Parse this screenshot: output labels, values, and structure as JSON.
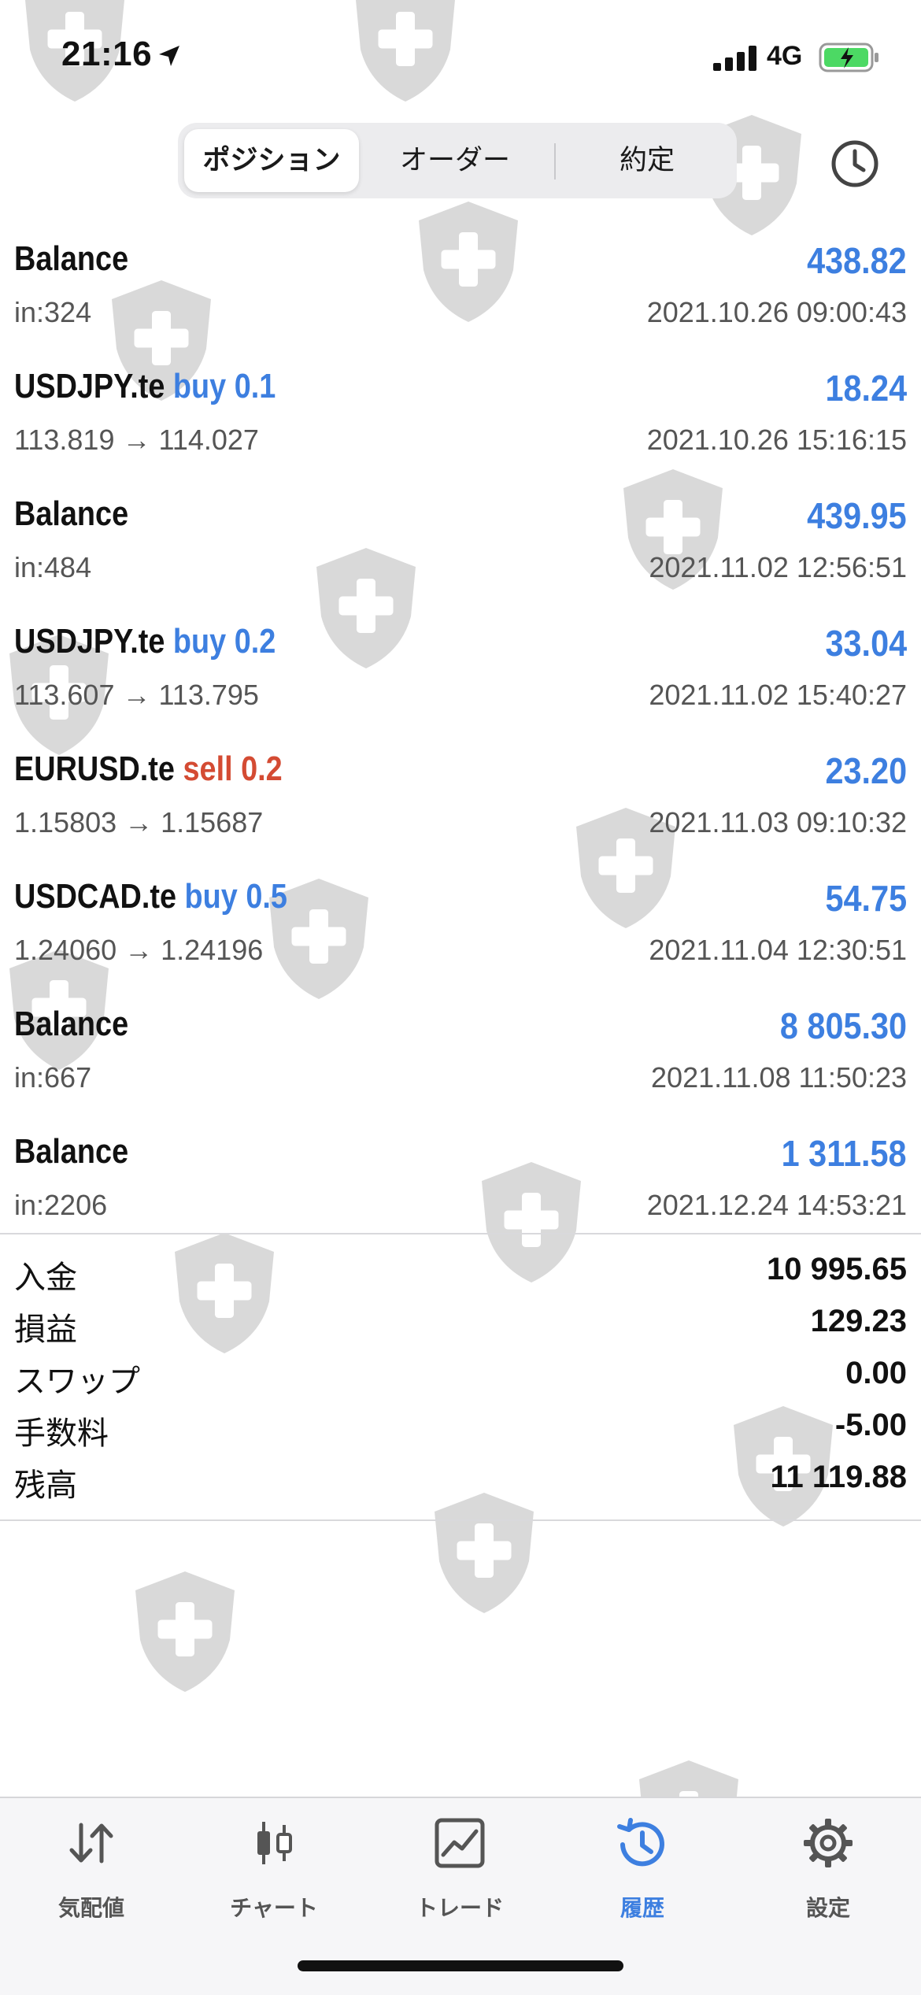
{
  "status_bar": {
    "time": "21:16",
    "network": "4G"
  },
  "segments": [
    {
      "label": "ポジション",
      "active": true
    },
    {
      "label": "オーダー",
      "active": false
    },
    {
      "label": "約定",
      "active": false
    }
  ],
  "rows": [
    {
      "symbol": "Balance",
      "side": "",
      "sub": "in:324",
      "profit": "438.82",
      "date": "2021.10.26 09:00:43"
    },
    {
      "symbol": "USDJPY.te",
      "side": "buy 0.1",
      "sub": "113.819 → 114.027",
      "profit": "18.24",
      "date": "2021.10.26 15:16:15"
    },
    {
      "symbol": "Balance",
      "side": "",
      "sub": "in:484",
      "profit": "439.95",
      "date": "2021.11.02 12:56:51"
    },
    {
      "symbol": "USDJPY.te",
      "side": "buy 0.2",
      "sub": "113.607 → 113.795",
      "profit": "33.04",
      "date": "2021.11.02 15:40:27"
    },
    {
      "symbol": "EURUSD.te",
      "side": "sell 0.2",
      "sub": "1.15803 → 1.15687",
      "profit": "23.20",
      "date": "2021.11.03 09:10:32"
    },
    {
      "symbol": "USDCAD.te",
      "side": "buy 0.5",
      "sub": "1.24060 → 1.24196",
      "profit": "54.75",
      "date": "2021.11.04 12:30:51"
    },
    {
      "symbol": "Balance",
      "side": "",
      "sub": "in:667",
      "profit": "8 805.30",
      "date": "2021.11.08 11:50:23"
    },
    {
      "symbol": "Balance",
      "side": "",
      "sub": "in:2206",
      "profit": "1 311.58",
      "date": "2021.12.24 14:53:21"
    }
  ],
  "summary": [
    {
      "label": "入金",
      "value": "10 995.65"
    },
    {
      "label": "損益",
      "value": "129.23"
    },
    {
      "label": "スワップ",
      "value": "0.00"
    },
    {
      "label": "手数料",
      "value": "-5.00"
    },
    {
      "label": "残高",
      "value": "11 119.88"
    }
  ],
  "tabs": [
    {
      "label": "気配値",
      "icon": "quotes-icon",
      "active": false
    },
    {
      "label": "チャート",
      "icon": "chart-icon",
      "active": false
    },
    {
      "label": "トレード",
      "icon": "trade-icon",
      "active": false
    },
    {
      "label": "履歴",
      "icon": "history-icon",
      "active": true
    },
    {
      "label": "設定",
      "icon": "gear-icon",
      "active": false
    }
  ],
  "colors": {
    "accent": "#3d7fe0",
    "sell": "#d44b33",
    "text": "#111111",
    "muted": "#555555"
  },
  "icons": [
    "location-arrow-icon",
    "signal-icon",
    "battery-charging-icon",
    "clock-icon",
    "shield-watermark-icon"
  ]
}
